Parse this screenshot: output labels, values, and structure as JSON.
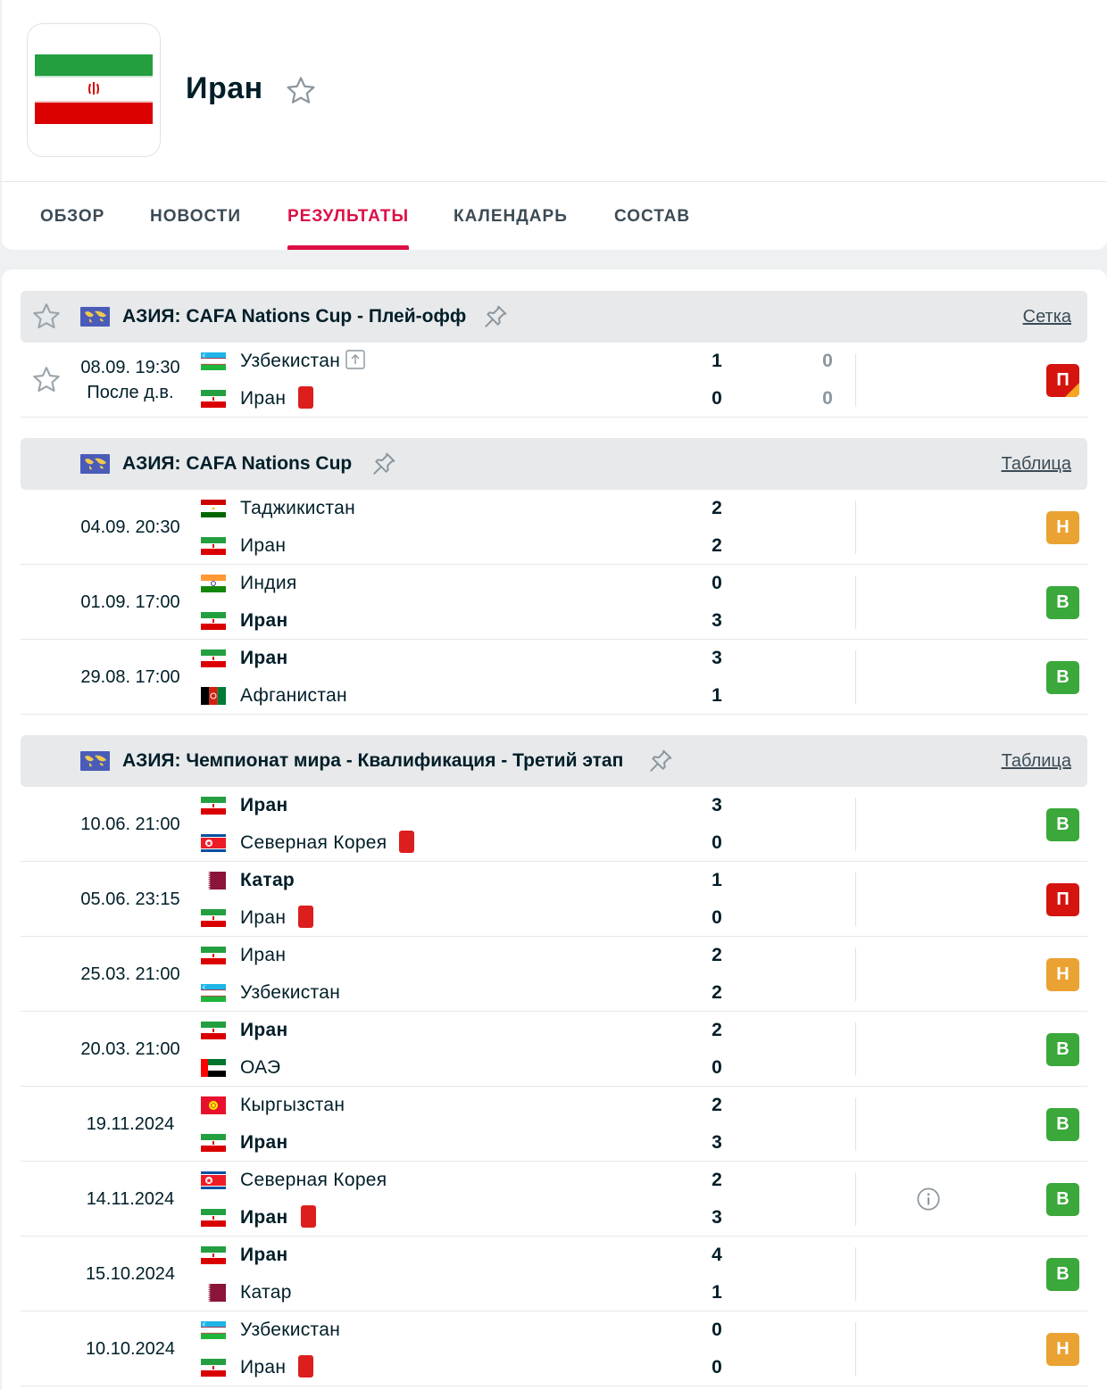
{
  "team": {
    "name": "Иран"
  },
  "tabs": [
    {
      "label": "ОБЗОР"
    },
    {
      "label": "НОВОСТИ"
    },
    {
      "label": "РЕЗУЛЬТАТЫ"
    },
    {
      "label": "КАЛЕНДАРЬ"
    },
    {
      "label": "СОСТАВ"
    }
  ],
  "active_tab": "РЕЗУЛЬТАТЫ",
  "colors": {
    "accent": "#dc0f46",
    "win": "#3aa83a",
    "draw": "#eaa232",
    "loss": "#d5140f"
  },
  "leagues": [
    {
      "name": "АЗИЯ: CAFA Nations Cup - Плей-офф",
      "link": "Сетка",
      "matches": [
        {
          "date": "08.09. 19:30",
          "stage": "После д.в.",
          "home": {
            "name": "Узбекистан",
            "flag": "uzbekistan",
            "bold": false,
            "advanced": true
          },
          "away": {
            "name": "Иран",
            "flag": "iran",
            "bold": false,
            "red_card": true
          },
          "score_home": "1",
          "score_away": "0",
          "extra_home": "0",
          "extra_away": "0",
          "result": "П",
          "result_type": "loss"
        }
      ]
    },
    {
      "name": "АЗИЯ: CAFA Nations Cup",
      "link": "Таблица",
      "matches": [
        {
          "date": "04.09. 20:30",
          "home": {
            "name": "Таджикистан",
            "flag": "tajikistan"
          },
          "away": {
            "name": "Иран",
            "flag": "iran"
          },
          "score_home": "2",
          "score_away": "2",
          "result": "Н",
          "result_type": "draw"
        },
        {
          "date": "01.09. 17:00",
          "home": {
            "name": "Индия",
            "flag": "india"
          },
          "away": {
            "name": "Иран",
            "flag": "iran",
            "bold": true
          },
          "score_home": "0",
          "score_away": "3",
          "result": "В",
          "result_type": "win"
        },
        {
          "date": "29.08. 17:00",
          "home": {
            "name": "Иран",
            "flag": "iran",
            "bold": true
          },
          "away": {
            "name": "Афганистан",
            "flag": "afghanistan"
          },
          "score_home": "3",
          "score_away": "1",
          "result": "В",
          "result_type": "win"
        }
      ]
    },
    {
      "name": "АЗИЯ: Чемпионат мира - Квалификация - Третий этап",
      "link": "Таблица",
      "matches": [
        {
          "date": "10.06. 21:00",
          "home": {
            "name": "Иран",
            "flag": "iran",
            "bold": true
          },
          "away": {
            "name": "Северная Корея",
            "flag": "northkorea",
            "red_card": true
          },
          "score_home": "3",
          "score_away": "0",
          "result": "В",
          "result_type": "win"
        },
        {
          "date": "05.06. 23:15",
          "home": {
            "name": "Катар",
            "flag": "qatar",
            "bold": true
          },
          "away": {
            "name": "Иран",
            "flag": "iran",
            "red_card": true
          },
          "score_home": "1",
          "score_away": "0",
          "result": "П",
          "result_type": "loss"
        },
        {
          "date": "25.03. 21:00",
          "home": {
            "name": "Иран",
            "flag": "iran"
          },
          "away": {
            "name": "Узбекистан",
            "flag": "uzbekistan"
          },
          "score_home": "2",
          "score_away": "2",
          "result": "Н",
          "result_type": "draw"
        },
        {
          "date": "20.03. 21:00",
          "home": {
            "name": "Иран",
            "flag": "iran",
            "bold": true
          },
          "away": {
            "name": "ОАЭ",
            "flag": "uae"
          },
          "score_home": "2",
          "score_away": "0",
          "result": "В",
          "result_type": "win"
        },
        {
          "date": "19.11.2024",
          "home": {
            "name": "Кыргызстан",
            "flag": "kyrgyzstan"
          },
          "away": {
            "name": "Иран",
            "flag": "iran",
            "bold": true
          },
          "score_home": "2",
          "score_away": "3",
          "result": "В",
          "result_type": "win"
        },
        {
          "date": "14.11.2024",
          "home": {
            "name": "Северная Корея",
            "flag": "northkorea"
          },
          "away": {
            "name": "Иран",
            "flag": "iran",
            "bold": true,
            "red_card": true
          },
          "score_home": "2",
          "score_away": "3",
          "result": "В",
          "result_type": "win",
          "info": true
        },
        {
          "date": "15.10.2024",
          "home": {
            "name": "Иран",
            "flag": "iran",
            "bold": true
          },
          "away": {
            "name": "Катар",
            "flag": "qatar"
          },
          "score_home": "4",
          "score_away": "1",
          "result": "В",
          "result_type": "win"
        },
        {
          "date": "10.10.2024",
          "home": {
            "name": "Узбекистан",
            "flag": "uzbekistan"
          },
          "away": {
            "name": "Иран",
            "flag": "iran",
            "red_card": true
          },
          "score_home": "0",
          "score_away": "0",
          "result": "Н",
          "result_type": "draw"
        }
      ]
    }
  ]
}
